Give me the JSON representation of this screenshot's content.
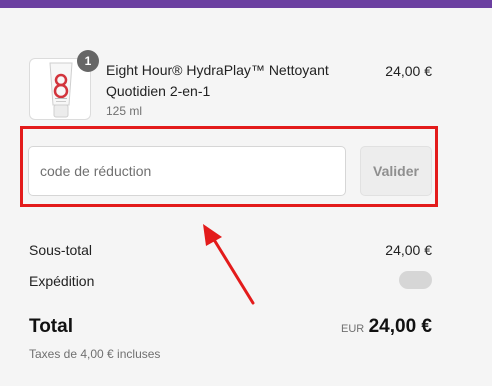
{
  "colors": {
    "header_bar": "#6b3fa0",
    "highlight": "#e31b1b"
  },
  "line_item": {
    "quantity": "1",
    "name": "Eight Hour® HydraPlay™ Nettoyant Quotidien 2-en-1",
    "variant": "125 ml",
    "price": "24,00 €",
    "thumbnail_icon": "product-tube-image"
  },
  "discount": {
    "placeholder": "code de réduction",
    "value": "",
    "apply_label": "Valider"
  },
  "summary": {
    "subtotal_label": "Sous-total",
    "subtotal_value": "24,00 €",
    "shipping_label": "Expédition",
    "total_label": "Total",
    "currency": "EUR",
    "total_value": "24,00 €",
    "tax_note": "Taxes de 4,00 € incluses"
  }
}
